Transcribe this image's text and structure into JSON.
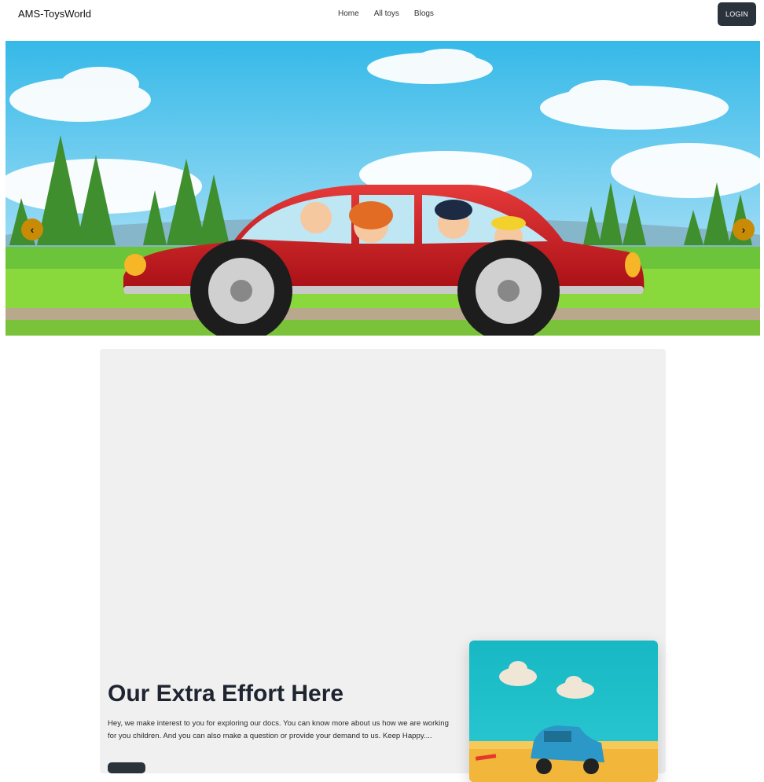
{
  "navbar": {
    "brand": "AMS-ToysWorld",
    "links": [
      "Home",
      "All toys",
      "Blogs"
    ],
    "login_label": "LOGIN"
  },
  "hero": {
    "prev_icon": "chevron-left-icon",
    "next_icon": "chevron-right-icon",
    "prev_glyph": "‹",
    "next_glyph": "›",
    "arrow_color": "#c98a06"
  },
  "section": {
    "title": "Our Extra Effort Here",
    "text": "Hey, we make interest to you for exploring our docs. You can know more about us how we are working for you children. And you can also make a question or provide your demand to us. Keep Happy...."
  },
  "colors": {
    "button_dark": "#2a323c",
    "panel_bg": "#f0f0f0"
  }
}
